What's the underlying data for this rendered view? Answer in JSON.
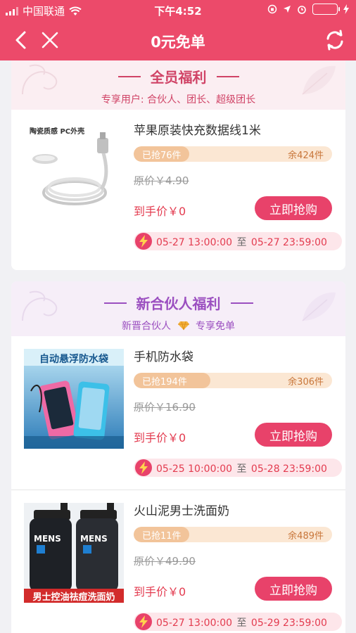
{
  "status_bar": {
    "carrier": "中国联通",
    "time": "下午4:52",
    "battery_level": 0.85
  },
  "nav": {
    "title": "0元免单"
  },
  "colors": {
    "brand": "#ec4a6a",
    "button": "#e8426a",
    "price": "#e33b4f"
  },
  "sections": [
    {
      "title": "全员福利",
      "subtitle": "专享用户: 合伙人、团长、超级团长",
      "items": [
        {
          "name": "苹果原装快充数据线1米",
          "image_caption": "陶瓷质感 PC外壳",
          "sold": "已抢76件",
          "remaining": "余424件",
          "sold_fraction": 0.152,
          "original_price": "原价￥4.90",
          "final_price": "到手价￥0",
          "buy_label": "立即抢购",
          "start": "05-27 13:00:00",
          "to": "至",
          "end": "05-27 23:59:00"
        }
      ]
    },
    {
      "title": "新合伙人福利",
      "subtitle_left": "新晋合伙人",
      "subtitle_right": "专享免单",
      "items": [
        {
          "name": "手机防水袋",
          "image_caption": "自动悬浮防水袋",
          "sold": "已抢194件",
          "remaining": "余306件",
          "sold_fraction": 0.388,
          "original_price": "原价￥16.90",
          "final_price": "到手价￥0",
          "buy_label": "立即抢购",
          "start": "05-25 10:00:00",
          "to": "至",
          "end": "05-28 23:59:00"
        },
        {
          "name": "火山泥男士洗面奶",
          "image_caption": "男士控油祛痘洗面奶",
          "image_brand": "MENS",
          "sold": "已抢11件",
          "remaining": "余489件",
          "sold_fraction": 0.022,
          "original_price": "原价￥49.90",
          "final_price": "到手价￥0",
          "buy_label": "立即抢购",
          "start": "05-27 13:00:00",
          "to": "至",
          "end": "05-29 23:59:00"
        }
      ]
    }
  ]
}
